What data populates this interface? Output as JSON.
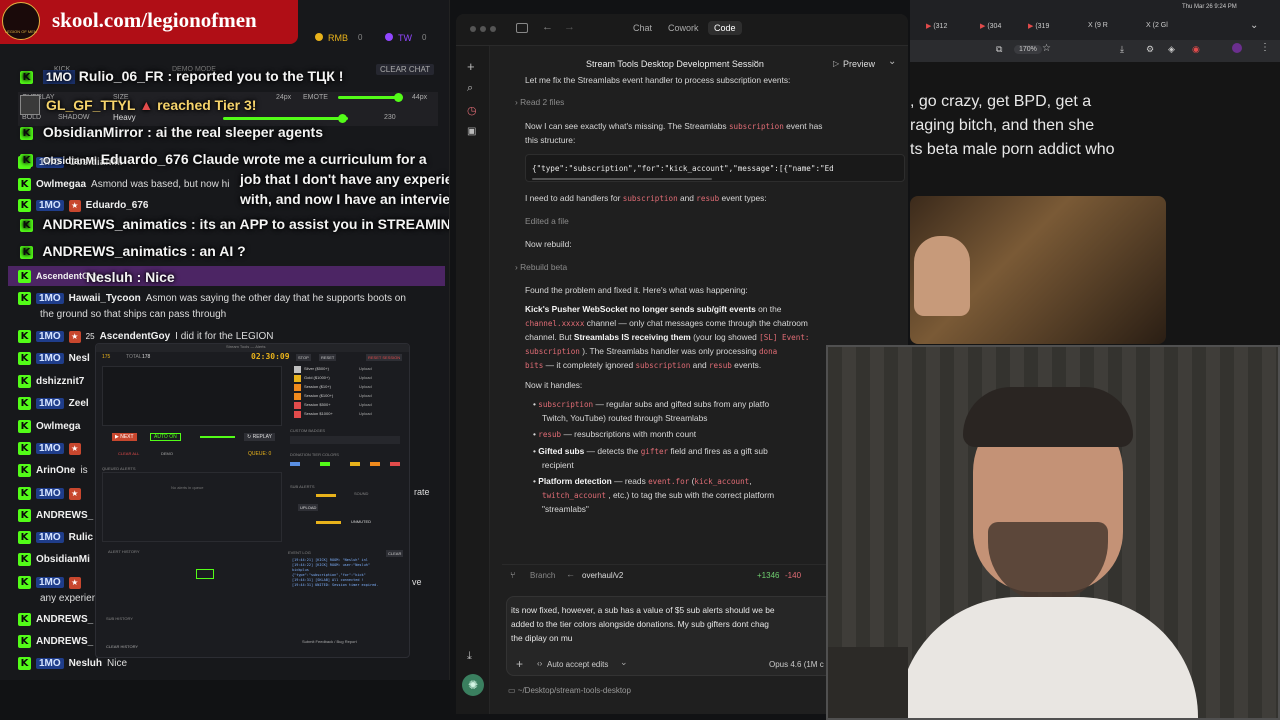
{
  "logo": {
    "banner_text": "skool.com/legionofmen",
    "badge_text": "LEGION OF MEN"
  },
  "chat_top": {
    "rmb": "RMB",
    "rmb_count": "0",
    "tw": "TW",
    "tw_count": "0",
    "clear_chat": "CLEAR CHAT",
    "demo_mode": "DEMO MODE",
    "kick": "KICK"
  },
  "overlay": {
    "row_labels": {
      "overlay": "OVERLAY",
      "size": "SIZE",
      "emote": "EMOTE",
      "bold": "BOLD",
      "shadow": "SHADOW",
      "heavy": "Heavy"
    },
    "values": {
      "px24": "24px",
      "px44": "44px",
      "v230": "230"
    }
  },
  "big_messages": [
    {
      "badge": "1MO",
      "user": "Rulio_06_FR",
      "text": ": reported you to the ТЦК !"
    },
    {
      "badge": "",
      "user": "GL_GF_TTYL",
      "text": "reached Tier 3!"
    },
    {
      "badge": "",
      "user": "ObsidianMirror",
      "text": ": ai the real sleeper agents"
    },
    {
      "badge": "",
      "user": "Eduardo_676",
      "text": "Claude wrote me a curriculum for a"
    },
    {
      "badge": "",
      "user": "",
      "text": "job that I don't have any experience"
    },
    {
      "badge": "",
      "user": "",
      "text": "with, and now I have an interview"
    },
    {
      "badge": "",
      "user": "ANDREWS_animatics",
      "text": ": its an APP to assist you in STREAMING ?"
    },
    {
      "badge": "",
      "user": "ANDREWS_animatics",
      "text": ": an AI ?"
    },
    {
      "badge": "",
      "user": "Nesluh",
      "text": ": Nice"
    }
  ],
  "chat_rows": [
    {
      "badge": "1MO",
      "user": "ObsidianMi",
      "text": ""
    },
    {
      "badge": "",
      "user": "Owlmegaa",
      "text": "Asmond was based, but now hi"
    },
    {
      "badge": "1MO",
      "user": "Eduardo_676",
      "text": ""
    },
    {
      "badge": "",
      "user": "AscendentGoy",
      "text": ""
    },
    {
      "badge": "1MO",
      "user": "Hawaii_Tycoon",
      "text": "Asmon was saying the other day that he supports boots on"
    },
    {
      "badge": "",
      "user": "",
      "text": "the ground so that ships can pass through"
    },
    {
      "badge": "1MO",
      "user": "AscendentGoy",
      "text": "I did it for the LEGION"
    },
    {
      "badge": "1MO",
      "user": "Nesl",
      "text": ""
    },
    {
      "badge": "",
      "user": "dshizznit7",
      "text": ""
    },
    {
      "badge": "1MO",
      "user": "Zeel",
      "text": ""
    },
    {
      "badge": "",
      "user": "Owlmega",
      "text": ""
    },
    {
      "badge": "1MO",
      "user": "",
      "text": ""
    },
    {
      "badge": "",
      "user": "ArinOne",
      "text": "is"
    },
    {
      "badge": "1MO",
      "user": "",
      "text": ""
    },
    {
      "badge": "",
      "user": "ANDREWS_",
      "text": ""
    },
    {
      "badge": "1MO",
      "user": "Rulic",
      "text": ""
    },
    {
      "badge": "",
      "user": "ObsidianMi",
      "text": ""
    },
    {
      "badge": "1MO",
      "user": "",
      "text": ""
    },
    {
      "badge": "",
      "user": "",
      "text": "any experien"
    },
    {
      "badge": "",
      "user": "ANDREWS_",
      "text": ""
    },
    {
      "badge": "",
      "user": "ANDREWS_",
      "text": ""
    },
    {
      "badge": "1MO",
      "user": "Nesluh",
      "text": "Nice"
    }
  ],
  "badges": {
    "mo25": "25",
    "gift": ""
  },
  "chat_fragments": {
    "rate": "rate",
    "ve": "ve",
    "hanzel": "ANDREWS_"
  },
  "mini_window": {
    "title": "Stream Tools — Alerts",
    "total_label": "TOTAL",
    "total_value": "178",
    "count_value": "175",
    "timer": "02:30:09",
    "stop": "STOP",
    "reset": "RESET",
    "reset_session": "RESET SESSION",
    "tiers": [
      "Silver ($500+)",
      "Gold ($1000+)",
      "Session ($10+)",
      "Session ($100+)",
      "Session $500+",
      "Session $1000+"
    ],
    "upload": "Upload",
    "next": "▶ NEXT",
    "auto_on": "AUTO ON",
    "replay": "↻ REPLAY",
    "clear_all": "CLEAR ALL",
    "demo": "DEMO",
    "queue": "QUEUE: 0",
    "queued_alerts": "QUEUED ALERTS",
    "no_alerts": "No alerts in queue",
    "custom_badges": "CUSTOM BADGES",
    "donation_colors": "DONATION TIER COLORS",
    "sub_alerts": "SUB ALERTS",
    "upload_btn": "UPLOAD",
    "sound": "SOUND",
    "muted": "UNMUTED",
    "alert_history": "ALERT HISTORY",
    "event_log": "EVENT LOG",
    "clear": "CLEAR",
    "sub_history": "SUB HISTORY",
    "clear_history": "CLEAR HISTORY",
    "submit_feedback": "Submit Feedback / Bug Report",
    "log_lines": [
      "[19:44:21] [KICK] ROOM: \"Nesluh\" inl",
      "[19:44:22] [KICK] ROOM: user:\"Nesluh\"",
      "kickplus",
      "{\"type\":\"subscription\",\"for\":\"kick\"",
      "[19:44:31] [SKLAB] All connected !",
      "[19:44:31] UNITED: Session timer expired."
    ]
  },
  "claude": {
    "tabs": [
      "Chat",
      "Cowork",
      "Code"
    ],
    "active_tab": "Code",
    "session_title": "Stream Tools Desktop Development Session",
    "preview": "Preview",
    "line0": "Let me fix the Streamlabs event handler to process subscription events:",
    "read_files": "Read 2 files",
    "p1a": "Now I can see exactly what's missing. The Streamlabs",
    "p1code": "subscription",
    "p1b": "event has",
    "p1c": "this structure:",
    "json_line": "{\"type\":\"subscription\",\"for\":\"kick_account\",\"message\":[{\"name\":\"Ed",
    "p2a": "I need to add handlers for",
    "p2code1": "subscription",
    "p2and": "and",
    "p2code2": "resub",
    "p2b": "event types:",
    "edited": "Edited a file",
    "rebuild": "Now rebuild:",
    "rebuild_beta": "Rebuild beta",
    "found": "Found the problem and fixed it. Here's what was happening:",
    "k1": "Kick's Pusher WebSocket no longer sends sub/gift events",
    "k1b": "on the",
    "k2code": "channel.xxxxx",
    "k2": "channel — only chat messages come through the chatroom",
    "k3": "channel. But",
    "k3b": "Streamlabs IS receiving them",
    "k3c": "(your log showed",
    "k3code": "[SL] Event:",
    "k4code": "subscription",
    "k4": "). The Streamlabs handler was only processing",
    "k4code2": "dona",
    "k5code": "bits",
    "k5": "— it completely ignored",
    "k5code2": "subscription",
    "k5and": "and",
    "k5code3": "resub",
    "k5b": "events.",
    "now_handles": "Now it handles:",
    "b1code": "subscription",
    "b1": "— regular subs and gifted subs from any platfo",
    "b1b": "Twitch, YouTube) routed through Streamlabs",
    "b2code": "resub",
    "b2": "— resubscriptions with month count",
    "b3h": "Gifted subs",
    "b3": "— detects the",
    "b3code": "gifter",
    "b3b": "field and fires as a gift sub",
    "b3c": "recipient",
    "b4h": "Platform detection",
    "b4": "— reads",
    "b4code": "event.for",
    "b4code2": "kick_account",
    "b4code3": "twitch_account",
    "b4b": ", etc.) to tag the sub with the correct platform",
    "b4c": "\"streamlabs\"",
    "branch_label": "Branch",
    "branch": "overhaul/v2",
    "diff_add": "+1346",
    "diff_del": "-140",
    "input_text": "its now fixed, however, a sub has a value of $5 sub alerts should we be",
    "input_text2": "added to the tier colors alongside donations. My sub gifters dont chag",
    "input_text3": "the diplay on mu",
    "auto_accept": "Auto accept edits",
    "model": "Opus 4.6 (1M c",
    "path": "~/Desktop/stream-tools-desktop"
  },
  "browser": {
    "tabs": [
      "(312",
      "(304",
      "(319",
      "(9 R",
      "(2 Gl"
    ],
    "zoom": "170%",
    "time": "Thu Mar 26  9:24 PM",
    "page_lines": [
      ", go crazy, get BPD, get a",
      " raging bitch, and then she",
      "ts beta male porn addict who"
    ]
  },
  "colors": {
    "kick_green": "#53fc18",
    "logo_red": "#b00e16",
    "accent_purple": "#6b2f8e",
    "code_red": "#e06c75"
  }
}
